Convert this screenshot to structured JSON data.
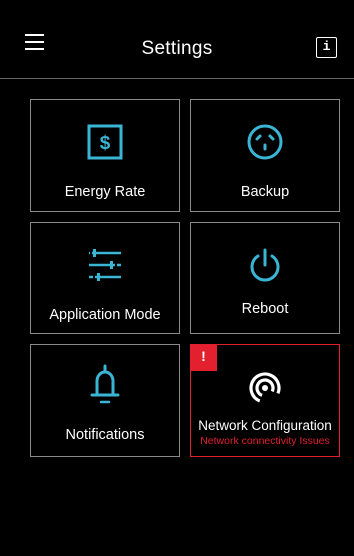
{
  "header": {
    "title": "Settings",
    "info_label": "i",
    "menu_icon": "hamburger-menu-icon"
  },
  "colors": {
    "background": "#000000",
    "accent": "#3ab5d4",
    "alert": "#e2202e",
    "tile_border": "#8a8a8a"
  },
  "tiles": [
    {
      "label": "Energy Rate",
      "icon": "dollar-sign-icon"
    },
    {
      "label": "Backup",
      "icon": "outlet-icon"
    },
    {
      "label": "Application Mode",
      "icon": "sliders-icon"
    },
    {
      "label": "Reboot",
      "icon": "power-icon"
    },
    {
      "label": "Notifications",
      "icon": "bell-icon"
    },
    {
      "label": "Network Configuration",
      "icon": "wireless-signal-icon",
      "alert_badge": "!",
      "status": "Network connectivity Issues"
    }
  ]
}
